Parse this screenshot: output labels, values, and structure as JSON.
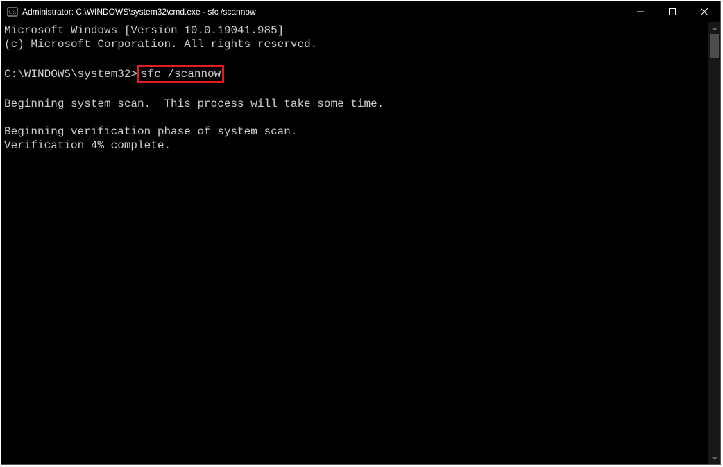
{
  "window": {
    "title": "Administrator: C:\\WINDOWS\\system32\\cmd.exe - sfc  /scannow"
  },
  "terminal": {
    "line1": "Microsoft Windows [Version 10.0.19041.985]",
    "line2": "(c) Microsoft Corporation. All rights reserved.",
    "blank1": "",
    "prompt": "C:\\WINDOWS\\system32>",
    "command": "sfc /scannow",
    "blank2": "",
    "line3": "Beginning system scan.  This process will take some time.",
    "blank3": "",
    "line4": "Beginning verification phase of system scan.",
    "line5": "Verification 4% complete."
  }
}
